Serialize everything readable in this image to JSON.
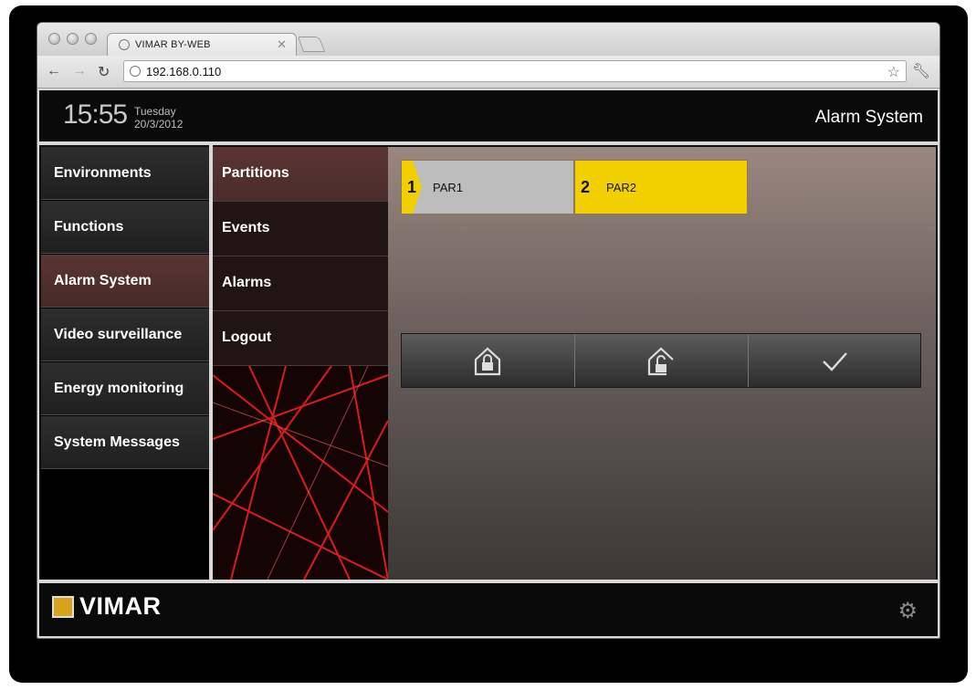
{
  "browser": {
    "tab_title": "VIMAR BY-WEB",
    "url": "192.168.0.110"
  },
  "header": {
    "time": "15:55",
    "weekday": "Tuesday",
    "date": "20/3/2012",
    "title": "Alarm System"
  },
  "left_menu": [
    {
      "label": "Environments",
      "active": false
    },
    {
      "label": "Functions",
      "active": false
    },
    {
      "label": "Alarm System",
      "active": true
    },
    {
      "label": "Video surveillance",
      "active": false
    },
    {
      "label": "Energy monitoring",
      "active": false
    },
    {
      "label": "System Messages",
      "active": false
    }
  ],
  "sub_menu": [
    {
      "label": "Partitions",
      "active": true
    },
    {
      "label": "Events",
      "active": false
    },
    {
      "label": "Alarms",
      "active": false
    },
    {
      "label": "Logout",
      "active": false
    }
  ],
  "partitions": [
    {
      "number": "1",
      "name": "PAR1",
      "color": "#bdbdbd",
      "flag_color": "#f2d000"
    },
    {
      "number": "2",
      "name": "PAR2",
      "color": "#f2d000",
      "flag_color": "#f2d000"
    }
  ],
  "actions": [
    {
      "icon": "house-lock-icon"
    },
    {
      "icon": "house-unlock-icon"
    },
    {
      "icon": "checkmark-icon"
    }
  ],
  "footer": {
    "brand": "VIMAR",
    "brand_color": "#d9a21d"
  },
  "colors": {
    "accent_active": "#52302e",
    "partition_yellow": "#f2d000"
  }
}
